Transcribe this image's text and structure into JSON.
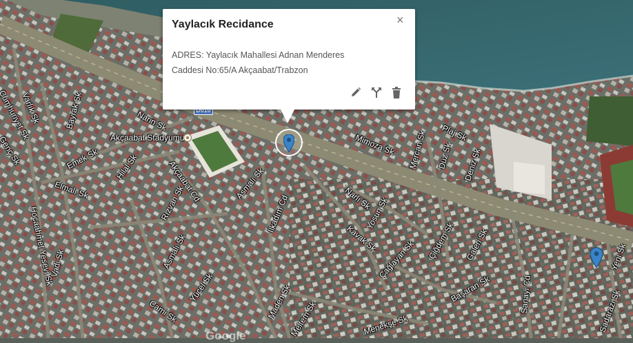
{
  "popup": {
    "title": "Yaylacık Recidance",
    "address_line1": "ADRES: Yaylacık Mahallesi Adnan Menderes",
    "address_line2": "Caddesi No:65/A Akçaabat/Trabzon",
    "close_symbol": "×",
    "tools": [
      "edit-icon",
      "route-icon",
      "delete-icon"
    ]
  },
  "map": {
    "road_shield": "D010",
    "google_logo": "Google",
    "marker_color": "#3a84c9",
    "labels": {
      "cumhuriyet": "Cumhuriyet Sk",
      "varlik": "Varlık Sk",
      "genc": "Genç Sk",
      "bayrak": "Bayrak Sk",
      "narin": "Narin Sk",
      "stadyum": "Akçaabat Stadyumu",
      "emek": "Emek Sk",
      "hilal": "Hilal Sk",
      "elmali": "Elmalı Sk",
      "akcaabat_cd": "Akçaabat Cd",
      "hocaahmet": "Hocaahmet Yesevi Sk",
      "vadi": "Vadi Sk",
      "rizvan": "Rızvan Sk",
      "asmali1": "Asmalı Sk",
      "asmali2": "Asmalı Sk",
      "ilkadim": "İlkadım Cd",
      "yucel": "Yücel Sk",
      "cami": "Cami Sk",
      "maden": "Maden Sk",
      "meltem": "Meltem Sk",
      "menekse": "Menekşe Sk",
      "mimoza": "Mimoza Sk",
      "plaj": "Plaj Sk",
      "mercan": "Mercan Sk",
      "duz": "Düz Sk",
      "deniz": "Deniz Sk",
      "narli": "Narlı Sk",
      "yosun": "Yosun Sk",
      "kavak": "Kavak Sk",
      "cicekli": "Çiçekli Sk",
      "caglayan": "Çağlayan Sk",
      "ciglem": "Çiğdem Sk",
      "galeri": "Galeri Sk",
      "basaran": "Başaran Sk",
      "sanayi": "Sanayi Cd",
      "yeni": "Yeni Sk",
      "sadarazi": "Sadarazi Sk"
    }
  }
}
